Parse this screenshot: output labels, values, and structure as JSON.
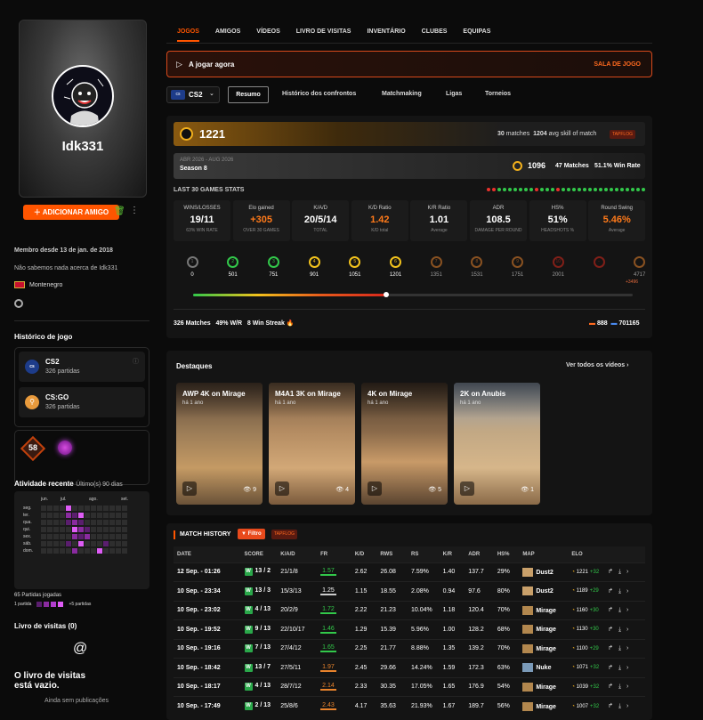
{
  "profile": {
    "username": "Idk331",
    "add_friend": "ADICIONAR AMIGO",
    "member_since": "Membro desde 13 de jan. de 2018",
    "about": "Não sabemos nada acerca de Idk331",
    "country": "Montenegro"
  },
  "game_history": {
    "title": "Histórico de jogo",
    "games": [
      {
        "name": "CS2",
        "count": "326 partidas"
      },
      {
        "name": "CS:GO",
        "count": "326 partidas"
      }
    ]
  },
  "badges": {
    "level": "58"
  },
  "activity": {
    "title": "Atividade recente",
    "range": "Último(s) 90 dias",
    "months": [
      "jun.",
      "jul.",
      "ago.",
      "set."
    ],
    "days": [
      "seg.",
      "ter.",
      "qua.",
      "qui.",
      "sex.",
      "sáb.",
      "dom."
    ],
    "played": "65 Partidas jogadas",
    "legend_low": "1 partida",
    "legend_high": "+5 partidas"
  },
  "guestbook": {
    "title": "Livro de visitas (0)",
    "empty": "O livro de visitas está vazio.",
    "sub": "Ainda sem publicações"
  },
  "nav": {
    "tabs": [
      "JOGOS",
      "AMIGOS",
      "VÍDEOS",
      "LIVRO DE VISITAS",
      "INVENTÁRIO",
      "CLUBES",
      "EQUIPAS"
    ]
  },
  "playing": {
    "label": "A jogar agora",
    "room": "SALA DE JOGO"
  },
  "subnav": {
    "game": "CS2",
    "tabs": [
      "Resumo",
      "Histórico dos confrontos",
      "Matchmaking",
      "Ligas",
      "Torneios"
    ]
  },
  "elo": {
    "value": "1221",
    "matches": "30",
    "matches_label": "matches",
    "avg": "1204",
    "avg_label": "avg skill of match",
    "badge": "TAPFLOG"
  },
  "season": {
    "dates": "ABR 2026 - AUG 2026",
    "name": "Season 8",
    "elo": "1096",
    "matches": "47 Matches",
    "winrate": "51.1% Win Rate"
  },
  "last30": {
    "title": "LAST 30 GAMES STATS",
    "results": [
      "L",
      "L",
      "W",
      "W",
      "W",
      "W",
      "W",
      "W",
      "W",
      "L",
      "W",
      "W",
      "W",
      "L",
      "W",
      "W",
      "W",
      "W",
      "W",
      "W",
      "W",
      "W",
      "W",
      "W",
      "W",
      "W",
      "W",
      "W",
      "W",
      "W"
    ]
  },
  "stats": [
    {
      "label": "WINS/LOSSES",
      "value": "19/11",
      "sub": "63% WIN RATE",
      "color": "#ffffff"
    },
    {
      "label": "Elo gained",
      "value": "+305",
      "sub": "OVER 30 GAMES",
      "color": "#ff7a1a"
    },
    {
      "label": "K/A/D",
      "value": "20/5/14",
      "sub": "TOTAL",
      "color": "#ffffff"
    },
    {
      "label": "K/D Ratio",
      "value": "1.42",
      "sub": "K/D total",
      "color": "#ff7a1a"
    },
    {
      "label": "K/R Ratio",
      "value": "1.01",
      "sub": "Average",
      "color": "#ffffff"
    },
    {
      "label": "ADR",
      "value": "108.5",
      "sub": "DAMAGE PER ROUND",
      "color": "#ffffff"
    },
    {
      "label": "HS%",
      "value": "51%",
      "sub": "HEADSHOTS %",
      "color": "#ffffff"
    },
    {
      "label": "Round Swing",
      "value": "5.46%",
      "sub": "Average",
      "color": "#ff7a1a"
    }
  ],
  "levels": [
    {
      "lvl": "1",
      "n": "0"
    },
    {
      "lvl": "2",
      "n": "501"
    },
    {
      "lvl": "3",
      "n": "751"
    },
    {
      "lvl": "4",
      "n": "901"
    },
    {
      "lvl": "5",
      "n": "1051"
    },
    {
      "lvl": "6",
      "n": "1201"
    },
    {
      "lvl": "7",
      "n": "1351"
    },
    {
      "lvl": "8",
      "n": "1531"
    },
    {
      "lvl": "9",
      "n": "1751"
    },
    {
      "lvl": "10",
      "n": "2001"
    },
    {
      "lvl": "-",
      "n": ""
    },
    {
      "lvl": "",
      "n": "4717"
    }
  ],
  "level_extra": "+3496",
  "elo_progress": 0.44,
  "footer": {
    "matches": "326 Matches",
    "wr": "49% W/R",
    "streak": "8 Win Streak",
    "rank1": "888",
    "rank2": "701165"
  },
  "highlights": {
    "title": "Destaques",
    "link": "Ver todos os vídeos",
    "items": [
      {
        "title": "AWP 4K on Mirage",
        "ago": "há 1 ano",
        "views": "9"
      },
      {
        "title": "M4A1 3K on Mirage",
        "ago": "há 1 ano",
        "views": "4"
      },
      {
        "title": "4K on Mirage",
        "ago": "há 1 ano",
        "views": "5"
      },
      {
        "title": "2K on Anubis",
        "ago": "há 1 ano",
        "views": "1"
      }
    ]
  },
  "history": {
    "title": "MATCH HISTORY",
    "filter": "Filtro",
    "badge": "TAPFLOG",
    "cols": [
      "DATE",
      "SCORE",
      "K/A/D",
      "FR",
      "K/D",
      "RWS",
      "RS",
      "K/R",
      "ADR",
      "HS%",
      "MAP",
      "ELO"
    ],
    "rows": [
      [
        "12 Sep. - 01:26",
        "13 / 2",
        "21/1/8",
        "1.57",
        "2.62",
        "26.08",
        "7.59%",
        "1.40",
        "137.7",
        "29%",
        "Dust2",
        "1221",
        "+32"
      ],
      [
        "10 Sep. - 23:34",
        "13 / 3",
        "15/3/13",
        "1.25",
        "1.15",
        "18.55",
        "2.08%",
        "0.94",
        "97.6",
        "80%",
        "Dust2",
        "1189",
        "+29"
      ],
      [
        "10 Sep. - 23:02",
        "4 / 13",
        "20/2/9",
        "1.72",
        "2.22",
        "21.23",
        "10.04%",
        "1.18",
        "120.4",
        "70%",
        "Mirage",
        "1160",
        "+30"
      ],
      [
        "10 Sep. - 19:52",
        "9 / 13",
        "22/10/17",
        "1.46",
        "1.29",
        "15.39",
        "5.96%",
        "1.00",
        "128.2",
        "68%",
        "Mirage",
        "1130",
        "+30"
      ],
      [
        "10 Sep. - 19:16",
        "7 / 13",
        "27/4/12",
        "1.65",
        "2.25",
        "21.77",
        "8.88%",
        "1.35",
        "139.2",
        "70%",
        "Mirage",
        "1100",
        "+29"
      ],
      [
        "10 Sep. - 18:42",
        "13 / 7",
        "27/5/11",
        "1.97",
        "2.45",
        "29.66",
        "14.24%",
        "1.59",
        "172.3",
        "63%",
        "Nuke",
        "1071",
        "+32"
      ],
      [
        "10 Sep. - 18:17",
        "4 / 13",
        "28/7/12",
        "2.14",
        "2.33",
        "30.35",
        "17.05%",
        "1.65",
        "176.9",
        "54%",
        "Mirage",
        "1039",
        "+32"
      ],
      [
        "10 Sep. - 17:49",
        "2 / 13",
        "25/8/6",
        "2.43",
        "4.17",
        "35.63",
        "21.93%",
        "1.67",
        "189.7",
        "56%",
        "Mirage",
        "1007",
        "+32"
      ]
    ]
  }
}
